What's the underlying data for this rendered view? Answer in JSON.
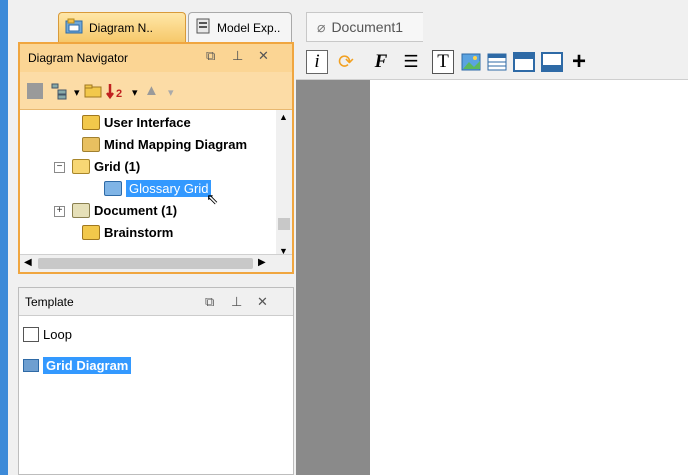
{
  "top_tabs": [
    {
      "label": "Diagram N..",
      "icon": "diagram-navigator-icon",
      "active": true
    },
    {
      "label": "Model Exp..",
      "icon": "model-explorer-icon",
      "active": false
    }
  ],
  "diagram_navigator": {
    "title": "Diagram Navigator",
    "controls": [
      "restore-icon",
      "pin-icon",
      "close-icon"
    ],
    "tree": [
      {
        "label": "User Interface",
        "icon": "user-interface-icon"
      },
      {
        "label": "Mind Mapping Diagram",
        "icon": "mind-mapping-icon"
      },
      {
        "label": "Grid (1)",
        "icon": "folder-icon",
        "expanded": true
      },
      {
        "label": "Glossary Grid",
        "icon": "grid-icon",
        "selected": true
      },
      {
        "label": "Document (1)",
        "icon": "document-icon",
        "expanded": false
      },
      {
        "label": "Brainstorm",
        "icon": "brainstorm-icon"
      }
    ]
  },
  "template": {
    "title": "Template",
    "items": [
      {
        "label": "Loop",
        "icon": "loop-icon"
      },
      {
        "label": "Grid Diagram",
        "icon": "grid-diagram-icon",
        "selected": true
      }
    ]
  },
  "document": {
    "tab_label": "Document1",
    "toolbar": [
      "info-icon",
      "refresh-icon",
      "font-icon",
      "list-icon",
      "text-icon",
      "image-icon",
      "table-icon",
      "header-icon",
      "footer-icon",
      "add-icon"
    ]
  },
  "colors": {
    "accent": "#3d8ad8",
    "panel_highlight": "#fbd594",
    "selection": "#3399ff",
    "canvas_bg": "#8a8a8a"
  }
}
